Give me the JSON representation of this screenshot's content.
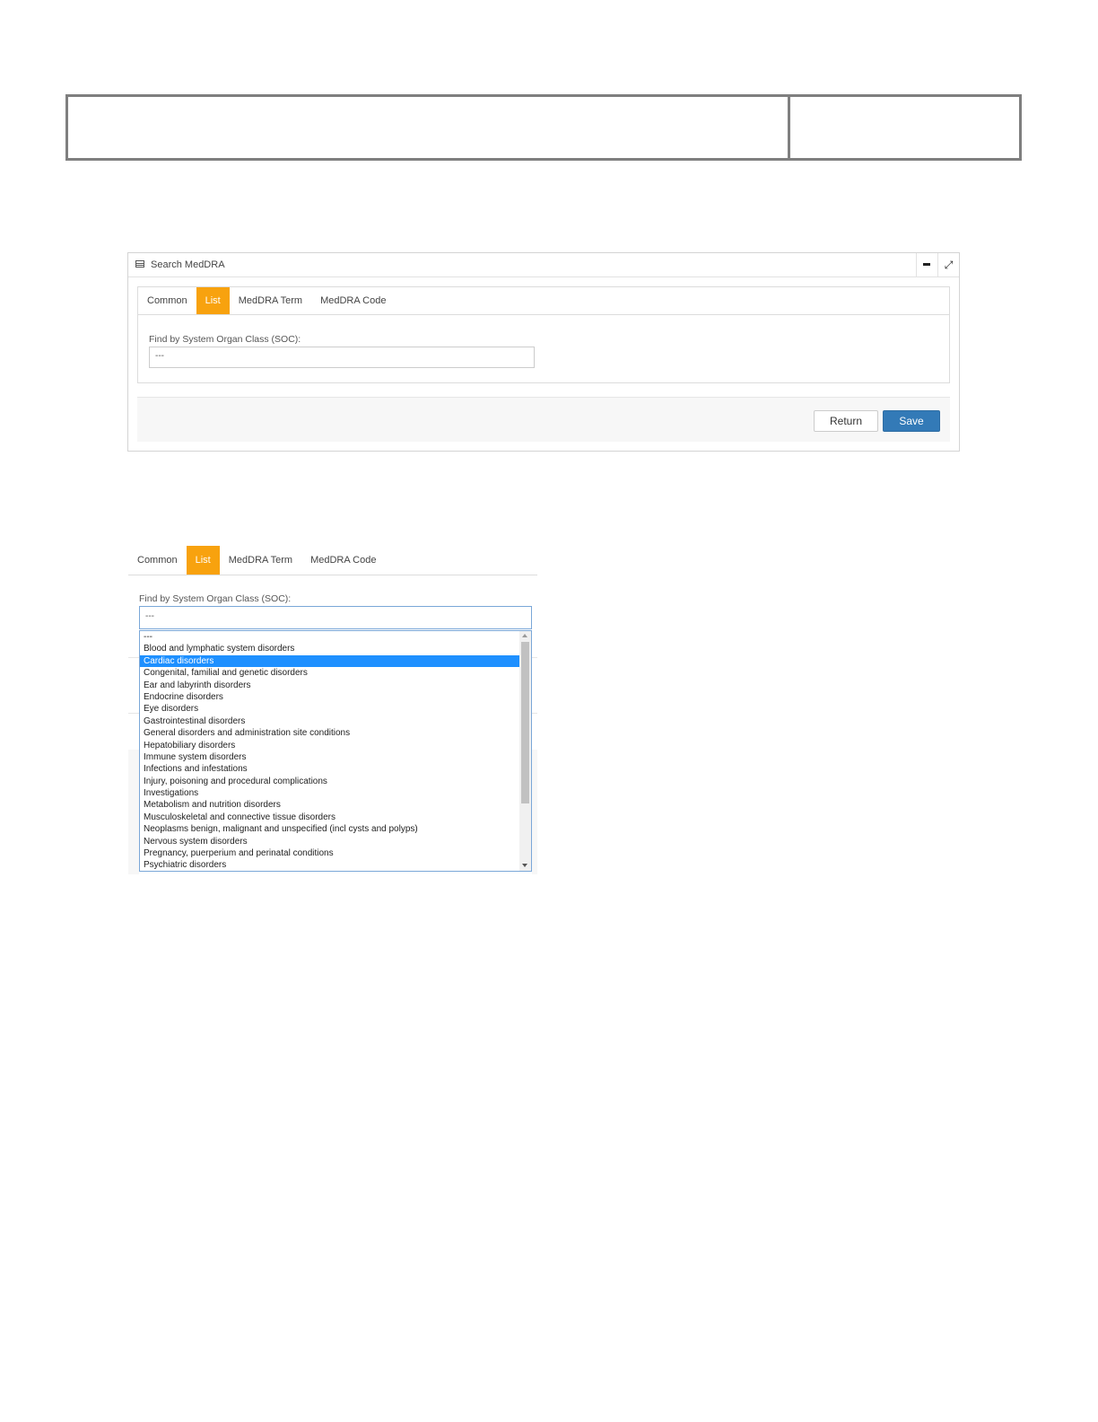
{
  "panel": {
    "title": "Search MedDRA",
    "minimize_icon": "minus-icon",
    "expand_icon": "expand-icon"
  },
  "tabs": [
    "Common",
    "List",
    "MedDRA Term",
    "MedDRA Code"
  ],
  "active_tab": "List",
  "field": {
    "label": "Find by System Organ Class (SOC):",
    "value": "---"
  },
  "buttons": {
    "return_label": "Return",
    "save_label": "Save"
  },
  "dropdown": {
    "label": "Find by System Organ Class (SOC):",
    "value": "---",
    "selected_option": "Cardiac disorders",
    "options": [
      "---",
      "Blood and lymphatic system disorders",
      "Cardiac disorders",
      "Congenital, familial and genetic disorders",
      "Ear and labyrinth disorders",
      "Endocrine disorders",
      "Eye disorders",
      "Gastrointestinal disorders",
      "General disorders and administration site conditions",
      "Hepatobiliary disorders",
      "Immune system disorders",
      "Infections and infestations",
      "Injury, poisoning and procedural complications",
      "Investigations",
      "Metabolism and nutrition disorders",
      "Musculoskeletal and connective tissue disorders",
      "Neoplasms benign, malignant and unspecified (incl cysts and polyps)",
      "Nervous system disorders",
      "Pregnancy, puerperium and perinatal conditions",
      "Psychiatric disorders"
    ]
  },
  "colors": {
    "active_tab": "#f8a20e",
    "save_button": "#337ab7",
    "selected_option": "#1e90ff"
  }
}
